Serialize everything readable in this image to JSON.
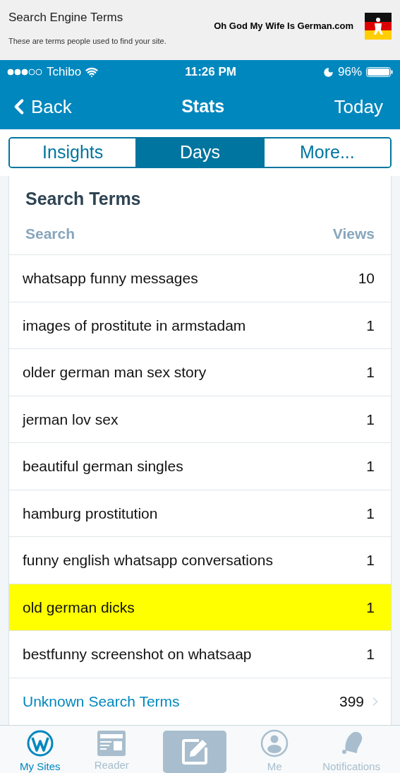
{
  "banner": {
    "title": "Search Engine Terms",
    "subtitle": "These are terms people used to find your site.",
    "site": "Oh God My Wife Is German.com"
  },
  "status_bar": {
    "carrier": "Tchibo",
    "time": "11:26 PM",
    "battery": "96%"
  },
  "nav": {
    "back": "Back",
    "title": "Stats",
    "action": "Today"
  },
  "tabs": [
    {
      "label": "Insights",
      "selected": false
    },
    {
      "label": "Days",
      "selected": true
    },
    {
      "label": "More...",
      "selected": false
    }
  ],
  "card": {
    "title": "Search Terms",
    "columns": [
      "Search",
      "Views"
    ],
    "rows": [
      {
        "term": "whatsapp funny messages",
        "views": "10",
        "highlighted": false
      },
      {
        "term": "images of prostitute in armstadam",
        "views": "1",
        "highlighted": false
      },
      {
        "term": "older german man sex story",
        "views": "1",
        "highlighted": false
      },
      {
        "term": "jerman lov sex",
        "views": "1",
        "highlighted": false
      },
      {
        "term": "beautiful german singles",
        "views": "1",
        "highlighted": false
      },
      {
        "term": "hamburg prostitution",
        "views": "1",
        "highlighted": false
      },
      {
        "term": "funny english whatsapp conversations",
        "views": "1",
        "highlighted": false
      },
      {
        "term": "old german dicks",
        "views": "1",
        "highlighted": true
      },
      {
        "term": "bestfunny screenshot on whatsaap",
        "views": "1",
        "highlighted": false
      }
    ],
    "footer": {
      "label": "Unknown Search Terms",
      "views": "399"
    }
  },
  "tab_bar": [
    {
      "kind": "sites",
      "label": "My Sites",
      "selected": true
    },
    {
      "kind": "reader",
      "label": "Reader",
      "selected": false
    },
    {
      "kind": "write",
      "selected": false
    },
    {
      "kind": "me",
      "label": "Me",
      "selected": false
    },
    {
      "kind": "notifications",
      "label": "Notifications",
      "selected": false
    }
  ]
}
